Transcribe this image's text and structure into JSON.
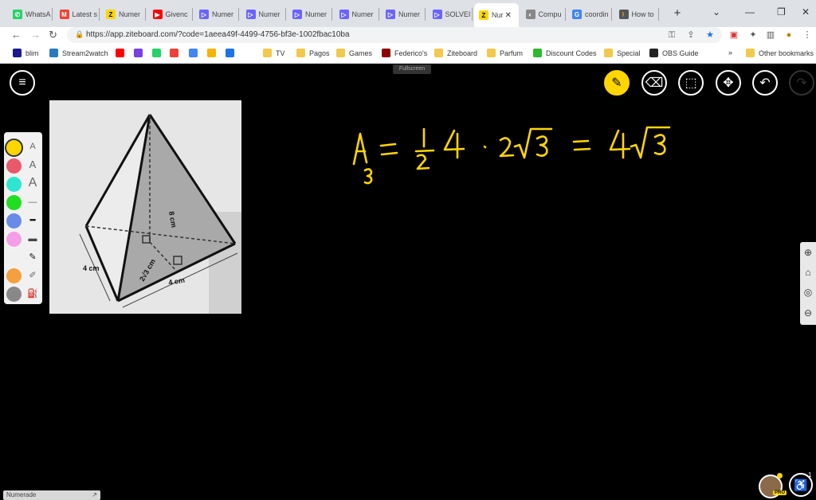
{
  "browser": {
    "tabs": [
      {
        "label": "WhatsA",
        "icon_color": "#25d366",
        "icon_char": "✆"
      },
      {
        "label": "Latest s",
        "icon_color": "#ea4335",
        "icon_char": "M"
      },
      {
        "label": "Numer",
        "icon_color": "#ffd600",
        "icon_char": "Z"
      },
      {
        "label": "Givenc",
        "icon_color": "#ff0000",
        "icon_char": "▶"
      },
      {
        "label": "Numer",
        "icon_color": "#6c63ff",
        "icon_char": "▷"
      },
      {
        "label": "Numer",
        "icon_color": "#6c63ff",
        "icon_char": "▷"
      },
      {
        "label": "Numer",
        "icon_color": "#6c63ff",
        "icon_char": "▷"
      },
      {
        "label": "Numer",
        "icon_color": "#6c63ff",
        "icon_char": "▷"
      },
      {
        "label": "Numer",
        "icon_color": "#6c63ff",
        "icon_char": "▷"
      },
      {
        "label": "SOLVEI",
        "icon_color": "#6c63ff",
        "icon_char": "▷"
      },
      {
        "label": "Nur",
        "icon_color": "#ffd600",
        "icon_char": "Z",
        "active": true
      },
      {
        "label": "Compu",
        "icon_color": "#888888",
        "icon_char": "◐"
      },
      {
        "label": "coordin",
        "icon_color": "#4285f4",
        "icon_char": "G"
      },
      {
        "label": "How to",
        "icon_color": "#555555",
        "icon_char": "🚶"
      }
    ],
    "url": "https://app.ziteboard.com/?code=1aeea49f-4499-4756-bf3e-1002fbac10ba",
    "bookmarks": [
      {
        "label": "blim",
        "color": "#1a1a8a"
      },
      {
        "label": "Stream2watch",
        "color": "#2a7ac0"
      },
      {
        "label": "",
        "color": "#ff0000"
      },
      {
        "label": "",
        "color": "#7b3fe4"
      },
      {
        "label": "",
        "color": "#25d366"
      },
      {
        "label": "",
        "color": "#ea4335"
      },
      {
        "label": "",
        "color": "#4285f4"
      },
      {
        "label": "",
        "color": "#f4b400"
      },
      {
        "label": "",
        "color": "#1a73e8"
      },
      {
        "label": "TV",
        "color": "#f2c94c"
      },
      {
        "label": "Pagos",
        "color": "#f2c94c"
      },
      {
        "label": "Games",
        "color": "#f2c94c"
      },
      {
        "label": "Federico's",
        "color": "#8b0000"
      },
      {
        "label": "Ziteboard",
        "color": "#f2c94c"
      },
      {
        "label": "Parfum",
        "color": "#f2c94c"
      },
      {
        "label": "Discount Codes",
        "color": "#2eb82e"
      },
      {
        "label": "Special",
        "color": "#f2c94c"
      },
      {
        "label": "OBS Guide",
        "color": "#222222"
      }
    ],
    "more_bookmarks": "»",
    "other_bookmarks": "Other bookmarks"
  },
  "whiteboard": {
    "fullscreen_tooltip": "Fullscreen",
    "equation_color": "#ffd600",
    "palette_colors": [
      "#ffd600",
      "#e85a6a",
      "#2ee6d0",
      "#22dd22",
      "#6a8ae8",
      "#f59ee8",
      "#f0f0f0",
      "#f5a040",
      "#888888"
    ],
    "figure": {
      "label_height": "8 cm",
      "label_slant": "2√3 cm",
      "label_left_edge": "4 cm",
      "label_base_edge": "4 cm"
    },
    "numerade_label": "Numerade",
    "pro_badge": "PRO",
    "notification_count": "1"
  }
}
